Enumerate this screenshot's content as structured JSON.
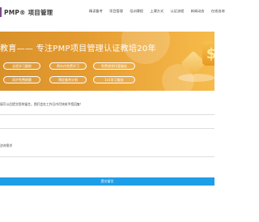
{
  "header": {
    "logo_text": "PMP® 项目管理",
    "nav": [
      "精读备考",
      "项目管理",
      "培训课程",
      "上课方式",
      "认证流程",
      "新闻动态",
      "在线咨询"
    ]
  },
  "banner": {
    "title": "教育—— 专注PMP项目管理认证教培20年",
    "pills": [
      "全程学习跟踪",
      "两年内免费学习",
      "免费课堂托管服务",
      "同步免费刷题",
      "预定备考计划",
      "1v1学习服务"
    ],
    "bg_color": "#e39a30"
  },
  "form": {
    "notice": "填写以后提交您的留言，我们会在工作日内尽快给予您回复！",
    "field_label": "咨询需求",
    "submit_label": "提交留言",
    "button_color": "#1e9ee8"
  }
}
